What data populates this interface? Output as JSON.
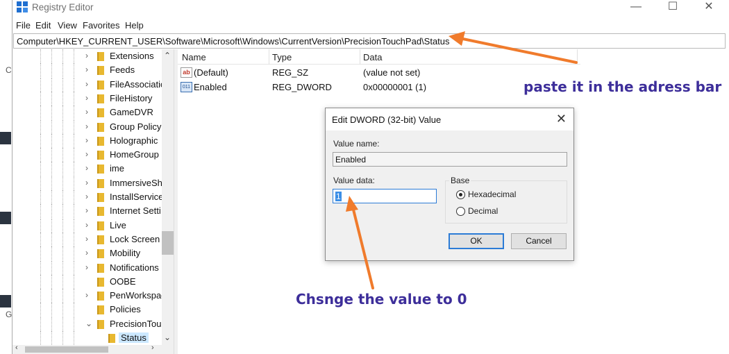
{
  "window": {
    "title": "Registry Editor",
    "controls": [
      "—",
      "☐",
      "✕"
    ]
  },
  "menu": [
    "File",
    "Edit",
    "View",
    "Favorites",
    "Help"
  ],
  "address": "Computer\\HKEY_CURRENT_USER\\Software\\Microsoft\\Windows\\CurrentVersion\\PrecisionTouchPad\\Status",
  "tree": {
    "items": [
      {
        "label": "Extensions",
        "expander": "›"
      },
      {
        "label": "Feeds",
        "expander": "›"
      },
      {
        "label": "FileAssociatic",
        "expander": "›"
      },
      {
        "label": "FileHistory",
        "expander": "›"
      },
      {
        "label": "GameDVR",
        "expander": "›"
      },
      {
        "label": "Group Policy",
        "expander": "›"
      },
      {
        "label": "Holographic",
        "expander": "›"
      },
      {
        "label": "HomeGroup",
        "expander": "›"
      },
      {
        "label": "ime",
        "expander": "›"
      },
      {
        "label": "ImmersiveSh",
        "expander": "›"
      },
      {
        "label": "InstallService",
        "expander": "›"
      },
      {
        "label": "Internet Setti",
        "expander": "›"
      },
      {
        "label": "Live",
        "expander": "›"
      },
      {
        "label": "Lock Screen",
        "expander": "›"
      },
      {
        "label": "Mobility",
        "expander": "›"
      },
      {
        "label": "Notifications",
        "expander": "›"
      },
      {
        "label": "OOBE",
        "expander": ""
      },
      {
        "label": "PenWorkspac",
        "expander": "›"
      },
      {
        "label": "Policies",
        "expander": ""
      },
      {
        "label": "PrecisionTou",
        "expander": "⌄"
      },
      {
        "label": "Status",
        "expander": ""
      }
    ]
  },
  "list": {
    "headers": [
      "Name",
      "Type",
      "Data"
    ],
    "rows": [
      {
        "icon": "ab",
        "name": "(Default)",
        "type": "REG_SZ",
        "data": "(value not set)"
      },
      {
        "icon": "011",
        "name": "Enabled",
        "type": "REG_DWORD",
        "data": "0x00000001 (1)"
      }
    ]
  },
  "dialog": {
    "title": "Edit DWORD (32-bit) Value",
    "close": "✕",
    "value_name_label": "Value name:",
    "value_name": "Enabled",
    "value_data_label": "Value data:",
    "value_data": "1",
    "base_label": "Base",
    "hex_label": "Hexadecimal",
    "dec_label": "Decimal",
    "ok_label": "OK",
    "cancel_label": "Cancel"
  },
  "annotations": {
    "address_note": "paste it in the adress bar",
    "value_note": "Chsnge the value to 0",
    "color": "#3d2e9a",
    "arrow_color": "#f07b2c"
  },
  "left_strip_glyphs": [
    "C",
    "G"
  ]
}
